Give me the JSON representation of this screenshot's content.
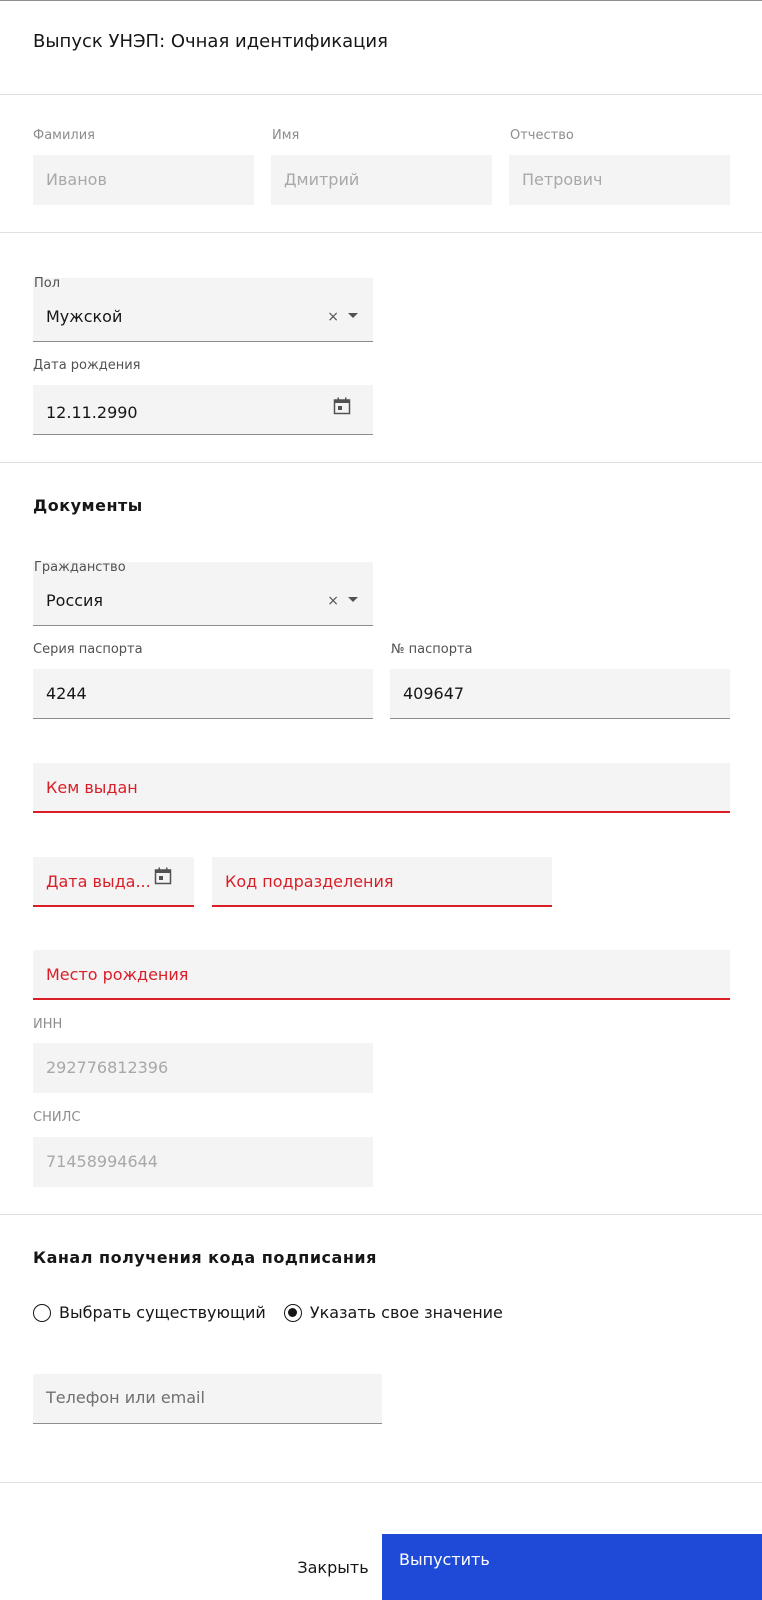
{
  "header": {
    "title": "Выпуск УНЭП: Очная идентификация"
  },
  "person": {
    "last_name": {
      "label": "Фамилия",
      "value": "Иванов"
    },
    "first_name": {
      "label": "Имя",
      "value": "Дмитрий"
    },
    "middle_name": {
      "label": "Отчество",
      "value": "Петрович"
    },
    "gender": {
      "label": "Пол",
      "value": "Мужской",
      "clear": "×"
    },
    "birth_date": {
      "label": "Дата рождения",
      "value": "12.11.2990"
    }
  },
  "documents": {
    "section_title": "Документы",
    "citizenship": {
      "label": "Гражданство",
      "value": "Россия",
      "clear": "×"
    },
    "passport_series": {
      "label": "Серия паспорта",
      "value": "4244"
    },
    "passport_number": {
      "label": "№ паспорта",
      "value": "409647"
    },
    "issued_by": {
      "placeholder": "Кем выдан"
    },
    "issue_date": {
      "placeholder": "Дата выда..."
    },
    "division_code": {
      "placeholder": "Код подразделения"
    },
    "birth_place": {
      "placeholder": "Место рождения"
    },
    "inn": {
      "label": "ИНН",
      "value": "292776812396"
    },
    "snils": {
      "label": "СНИЛС",
      "value": "71458994644"
    }
  },
  "signing_channel": {
    "section_title": "Канал получения кода подписания",
    "options": [
      {
        "label": "Выбрать существующий",
        "checked": false
      },
      {
        "label": "Указать свое значение",
        "checked": true
      }
    ],
    "contact": {
      "placeholder": "Телефон или email"
    }
  },
  "footer": {
    "close_label": "Закрыть",
    "submit_label": "Выпустить"
  },
  "colors": {
    "primary": "#1f4ad8",
    "error": "#da1e28",
    "field_bg": "#f4f4f4"
  }
}
